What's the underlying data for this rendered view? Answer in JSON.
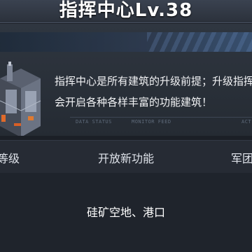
{
  "header": {
    "title": "指挥中心Lv.38"
  },
  "banner": {
    "description": "指挥中心是所有建筑的升级前提；升级指挥\n会开启各种各样丰富的功能建筑！",
    "status_labels": [
      "DATA STATUS",
      "MONITOR FEED",
      "ACT"
    ]
  },
  "table": {
    "columns": [
      "等级",
      "开放新功能",
      "军团"
    ],
    "rows": [
      {
        "new_features": "硅矿空地、港口"
      }
    ]
  }
}
